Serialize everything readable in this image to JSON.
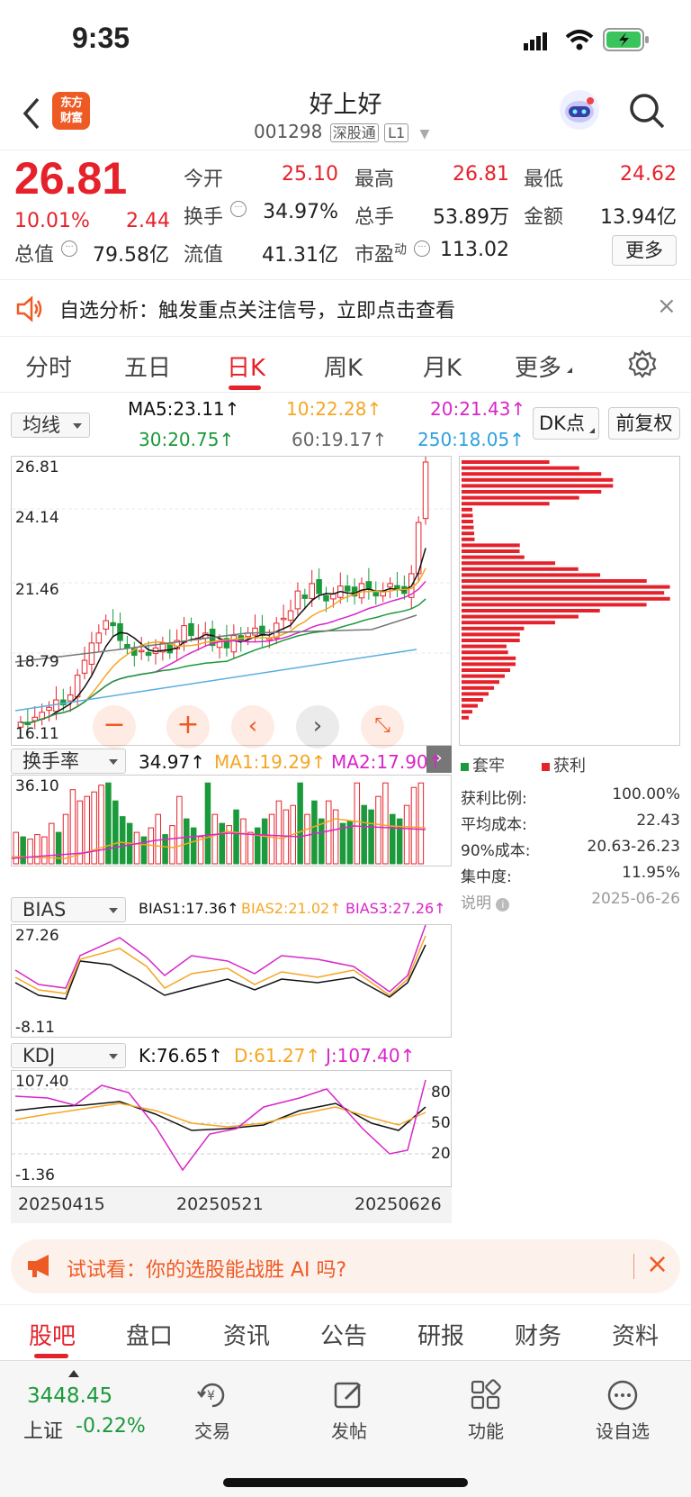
{
  "status": {
    "time": "9:35"
  },
  "nav": {
    "title": "好上好",
    "code": "001298",
    "market_tag": "深股通",
    "level_tag": "L1",
    "logo_text": "东方财富"
  },
  "quote": {
    "price": "26.81",
    "pct": "10.01%",
    "change": "2.44",
    "open_label": "今开",
    "open": "25.10",
    "high_label": "最高",
    "high": "26.81",
    "low_label": "最低",
    "low": "24.62",
    "turnover_label": "换手",
    "turnover": "34.97%",
    "vol_label": "总手",
    "vol": "53.89万",
    "amount_label": "金额",
    "amount": "13.94亿",
    "mcap_label": "总值",
    "mcap": "79.58亿",
    "float_label": "流值",
    "float": "41.31亿",
    "pe_label": "市盈",
    "pe_sup": "动",
    "pe": "113.02",
    "more": "更多"
  },
  "banner": {
    "text": "自选分析：触发重点关注信号，立即点击查看"
  },
  "tabs": [
    "分时",
    "五日",
    "日K",
    "周K",
    "月K",
    "更多"
  ],
  "active_tab": "日K",
  "ma": {
    "select": "均线",
    "ma5": "MA5:23.11↑",
    "ma10": "10:22.28↑",
    "ma20": "20:21.43↑",
    "ma30": "30:20.75↑",
    "ma60": "60:19.17↑",
    "ma250": "250:18.05↑",
    "dk": "DK点",
    "fq": "前复权"
  },
  "price_axis": [
    "26.81",
    "24.14",
    "21.46",
    "18.79",
    "16.11"
  ],
  "vol_ind": {
    "select": "换手率",
    "val": "34.97↑",
    "ma1": "MA1:19.29↑",
    "ma2": "MA2:17.90↑",
    "top": "36.10"
  },
  "bias": {
    "select": "BIAS",
    "b1": "BIAS1:17.36↑",
    "b2": "BIAS2:21.02↑",
    "b3": "BIAS3:27.26↑",
    "top": "27.26",
    "bottom": "-8.11"
  },
  "kdj": {
    "select": "KDJ",
    "k": "K:76.65↑",
    "d": "D:61.27↑",
    "j": "J:107.40↑",
    "top": "107.40",
    "bottom": "-1.36",
    "l80": "80",
    "l50": "50",
    "l20": "20"
  },
  "dates": [
    "20250415",
    "20250521",
    "20250626"
  ],
  "chip": {
    "legend_trap": "套牢",
    "legend_profit": "获利",
    "rows": [
      {
        "label": "获利比例:",
        "value": "100.00%"
      },
      {
        "label": "平均成本:",
        "value": "22.43"
      },
      {
        "label": "90%成本:",
        "value": "20.63-26.23"
      },
      {
        "label": "集中度:",
        "value": "11.95%"
      }
    ],
    "note": "说明",
    "date": "2025-06-26"
  },
  "promo": {
    "text": "试试看：你的选股能战胜 AI 吗?"
  },
  "subtabs": [
    "股吧",
    "盘口",
    "资讯",
    "公告",
    "研报",
    "财务",
    "资料"
  ],
  "bottom": {
    "index_value": "3448.45",
    "index_name": "上证",
    "index_pct": "-0.22%",
    "trade": "交易",
    "post": "发帖",
    "func": "功能",
    "fav": "设自选"
  },
  "chart_data": {
    "type": "candlestick",
    "symbol": "001298",
    "x_start": "20250415",
    "x_end": "20250626",
    "ylim": [
      16.11,
      26.81
    ],
    "ohlc_close": [
      16.3,
      16.2,
      16.5,
      16.7,
      16.9,
      17.2,
      17.0,
      17.4,
      18.2,
      18.8,
      19.5,
      19.9,
      20.4,
      20.2,
      19.6,
      19.3,
      19.0,
      19.2,
      19.0,
      19.3,
      19.5,
      19.1,
      19.6,
      20.2,
      19.8,
      19.7,
      19.9,
      19.4,
      19.6,
      19.3,
      19.8,
      19.6,
      19.9,
      20.1,
      19.8,
      19.7,
      20.3,
      20.5,
      20.8,
      21.6,
      21.3,
      21.9,
      21.5,
      21.2,
      21.5,
      21.8,
      21.6,
      21.4,
      21.9,
      21.7,
      21.4,
      21.6,
      21.9,
      21.7,
      21.5,
      22.3,
      24.37,
      26.81
    ]
  }
}
